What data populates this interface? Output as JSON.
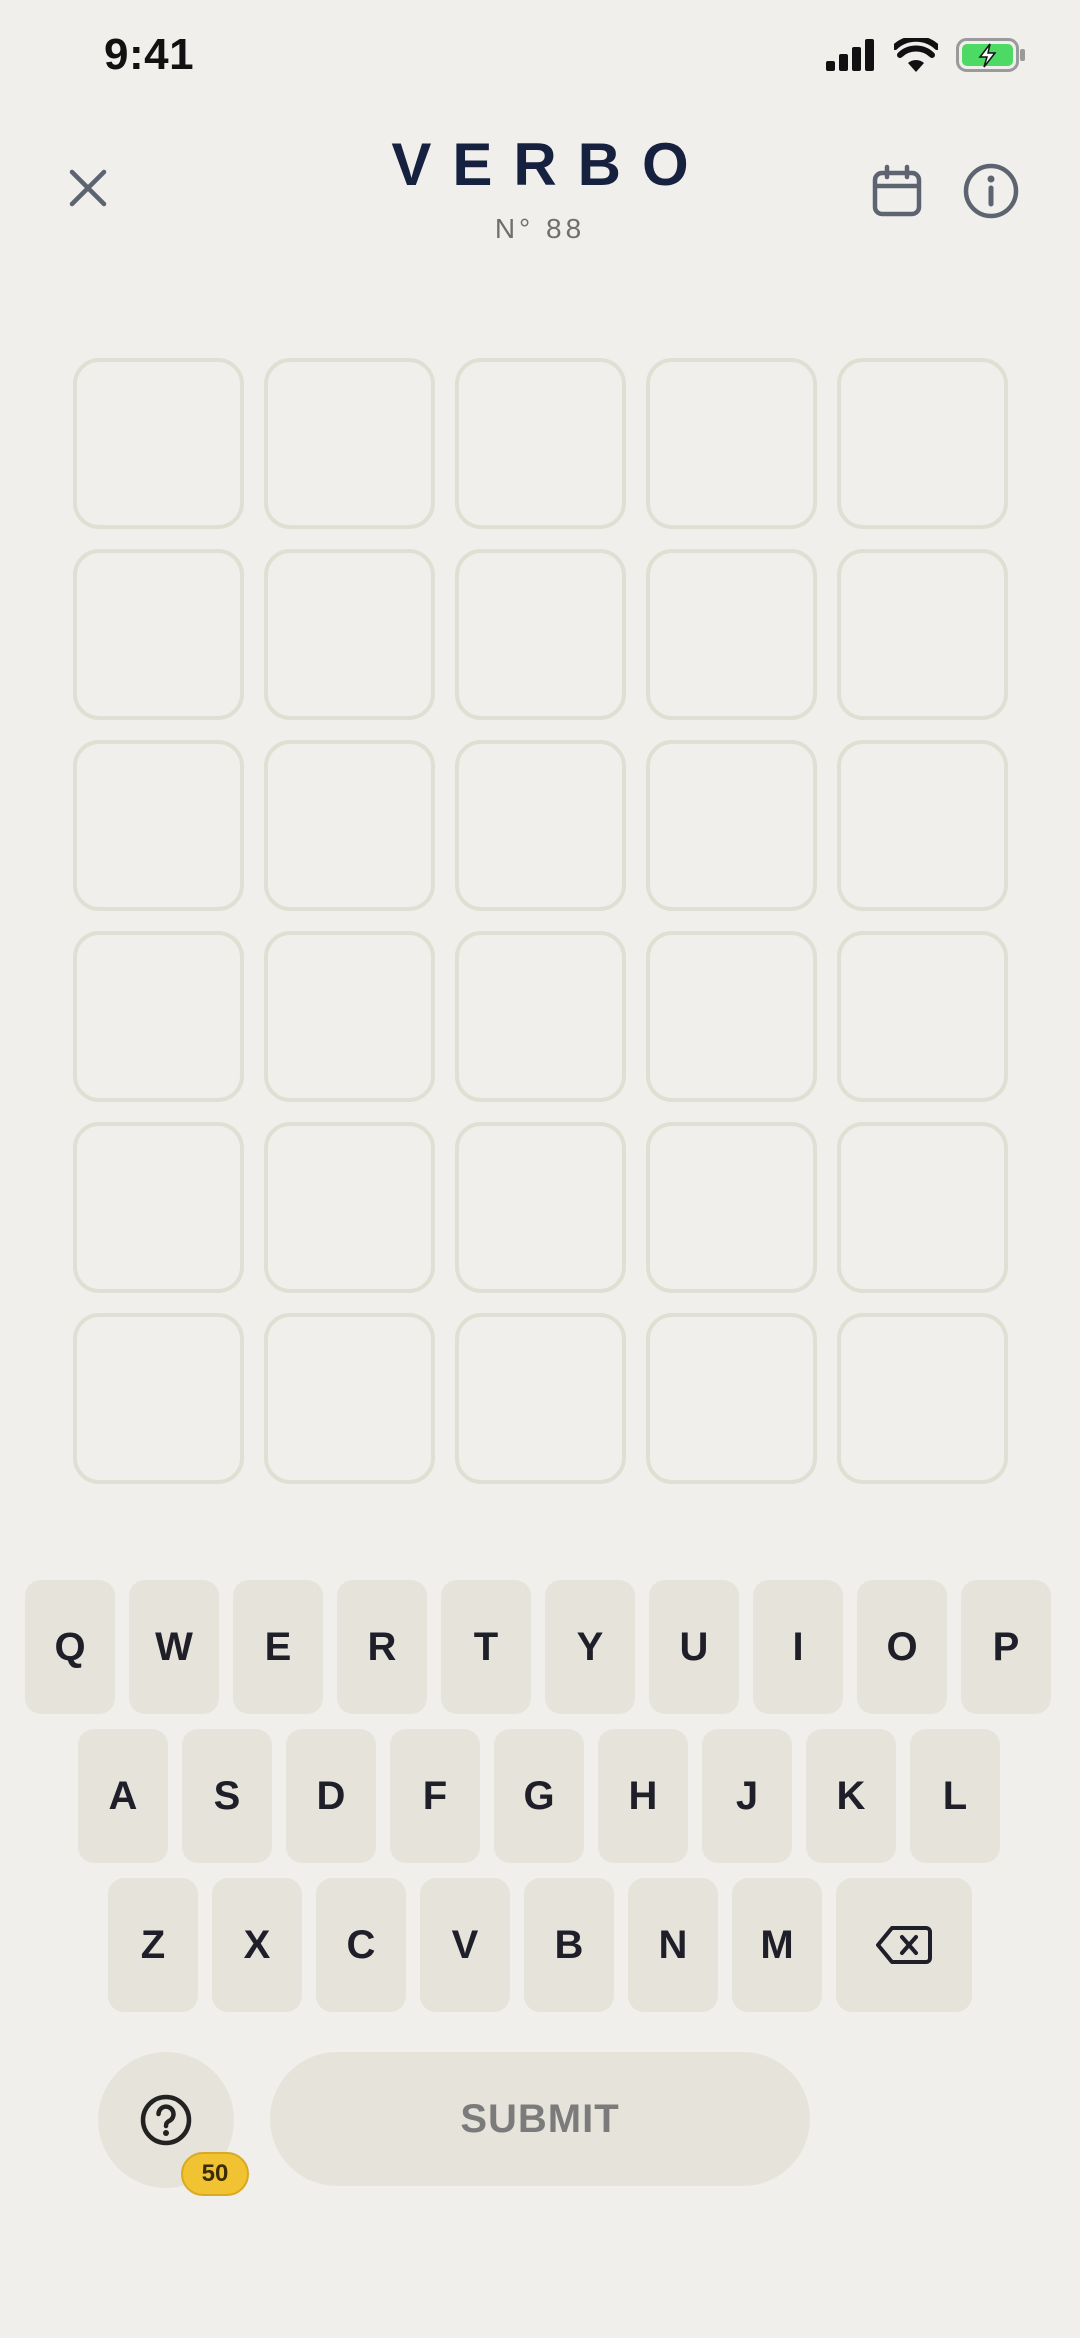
{
  "status_bar": {
    "time": "9:41",
    "icons": [
      "signal-bars-icon",
      "wifi-icon",
      "battery-charging-icon"
    ],
    "battery_color": "#4cd964"
  },
  "header": {
    "close_icon": "close-icon",
    "title": "VERBO",
    "puzzle_number": "N° 88",
    "calendar_icon": "calendar-icon",
    "info_icon": "info-icon"
  },
  "grid": {
    "rows": 6,
    "columns": 5,
    "tile_border_color": "#e0dfd3",
    "tiles": [
      [
        "",
        "",
        "",
        "",
        ""
      ],
      [
        "",
        "",
        "",
        "",
        ""
      ],
      [
        "",
        "",
        "",
        "",
        ""
      ],
      [
        "",
        "",
        "",
        "",
        ""
      ],
      [
        "",
        "",
        "",
        "",
        ""
      ],
      [
        "",
        "",
        "",
        "",
        ""
      ]
    ]
  },
  "keyboard": {
    "row1": [
      "Q",
      "W",
      "E",
      "R",
      "T",
      "Y",
      "U",
      "I",
      "O",
      "P"
    ],
    "row2": [
      "A",
      "S",
      "D",
      "F",
      "G",
      "H",
      "J",
      "K",
      "L"
    ],
    "row3": [
      "Z",
      "X",
      "C",
      "V",
      "B",
      "N",
      "M"
    ],
    "backspace_icon": "backspace-icon"
  },
  "footer": {
    "help_icon": "question-icon",
    "help_count": "50",
    "submit_label": "SUBMIT"
  },
  "colors": {
    "background": "#f0efeb",
    "title": "#15213f",
    "key_background": "#e6e3da",
    "badge": "#f1c232"
  }
}
